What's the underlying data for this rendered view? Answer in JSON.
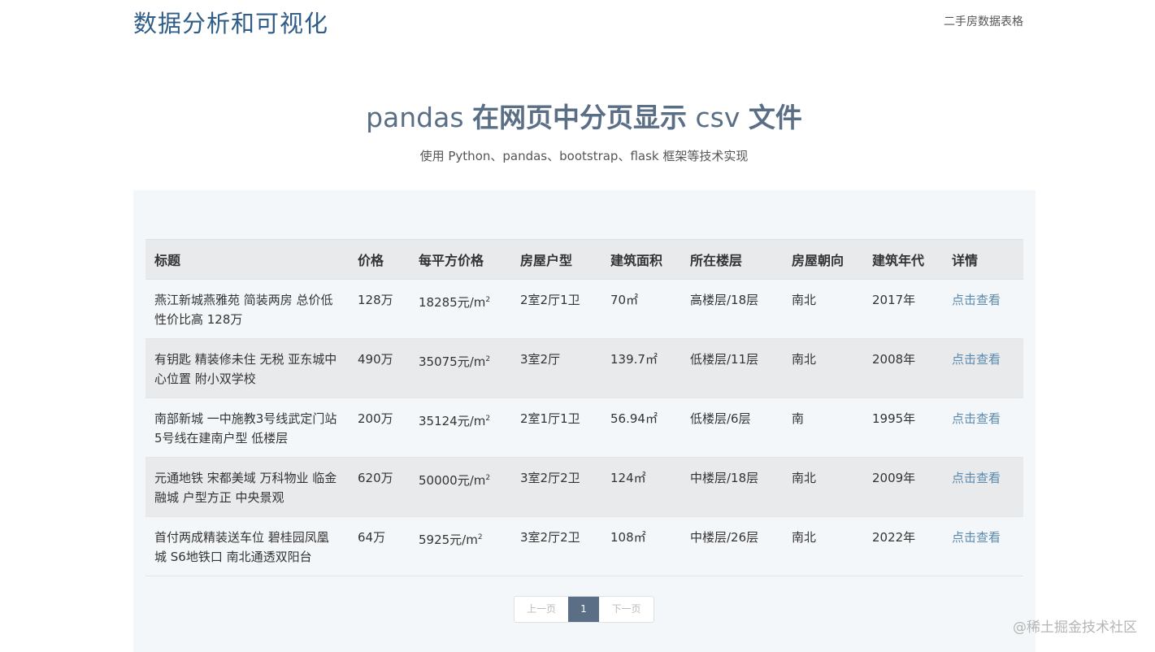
{
  "navbar": {
    "brand": "数据分析和可视化",
    "link": "二手房数据表格"
  },
  "hero": {
    "title_prefix": "pandas ",
    "title_mid1": "在网页中分页显示",
    "title_mid2": " csv ",
    "title_suffix": "文件",
    "subtitle": "使用 Python、pandas、bootstrap、flask 框架等技术实现"
  },
  "table": {
    "headers": [
      "标题",
      "价格",
      "每平方价格",
      "房屋户型",
      "建筑面积",
      "所在楼层",
      "房屋朝向",
      "建筑年代",
      "详情"
    ],
    "rows": [
      {
        "title": "燕江新城燕雅苑 简装两房 总价低 性价比高 128万",
        "price": "128万",
        "unit_price": "18285元/m",
        "layout": "2室2厅1卫",
        "area": "70㎡",
        "floor": "高楼层/18层",
        "orientation": "南北",
        "year": "2017年",
        "detail": "点击查看"
      },
      {
        "title": "有钥匙 精装修未住 无税 亚东城中心位置 附小双学校",
        "price": "490万",
        "unit_price": "35075元/m",
        "layout": "3室2厅",
        "area": "139.7㎡",
        "floor": "低楼层/11层",
        "orientation": "南北",
        "year": "2008年",
        "detail": "点击查看"
      },
      {
        "title": "南部新城 一中施教3号线武定门站 5号线在建南户型 低楼层",
        "price": "200万",
        "unit_price": "35124元/m",
        "layout": "2室1厅1卫",
        "area": "56.94㎡",
        "floor": "低楼层/6层",
        "orientation": "南",
        "year": "1995年",
        "detail": "点击查看"
      },
      {
        "title": "元通地铁 宋都美域 万科物业 临金融城 户型方正 中央景观",
        "price": "620万",
        "unit_price": "50000元/m",
        "layout": "3室2厅2卫",
        "area": "124㎡",
        "floor": "中楼层/18层",
        "orientation": "南北",
        "year": "2009年",
        "detail": "点击查看"
      },
      {
        "title": "首付两成精装送车位 碧桂园凤凰城 S6地铁口 南北通透双阳台",
        "price": "64万",
        "unit_price": "5925元/m",
        "layout": "3室2厅2卫",
        "area": "108㎡",
        "floor": "中楼层/26层",
        "orientation": "南北",
        "year": "2022年",
        "detail": "点击查看"
      }
    ],
    "unit_sup": "2"
  },
  "pagination": {
    "prev": "上一页",
    "current": "1",
    "next": "下一页"
  },
  "watermark": "@稀土掘金技术社区"
}
